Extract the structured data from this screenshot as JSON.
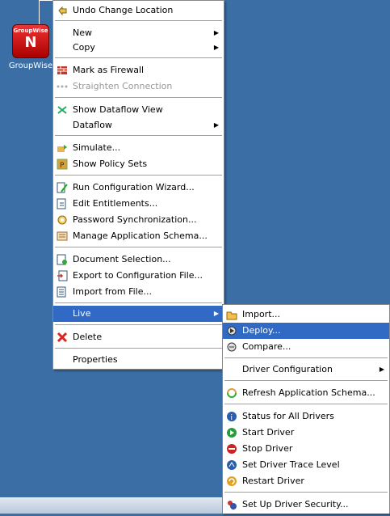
{
  "desktop": {
    "icon_label": "GroupWise",
    "icon_text_top": "GroupWise",
    "icon_text_main": "N"
  },
  "main_menu": {
    "undo": "Undo Change Location",
    "new": "New",
    "copy": "Copy",
    "mark_firewall": "Mark as Firewall",
    "straighten": "Straighten Connection",
    "show_dataflow": "Show Dataflow View",
    "dataflow": "Dataflow",
    "simulate": "Simulate...",
    "show_policy": "Show Policy Sets",
    "run_wizard": "Run Configuration Wizard...",
    "edit_entitlements": "Edit Entitlements...",
    "password_sync": "Password Synchronization...",
    "manage_schema": "Manage Application Schema...",
    "doc_selection": "Document Selection...",
    "export_config": "Export to Configuration File...",
    "import_file": "Import from File...",
    "live": "Live",
    "delete": "Delete",
    "properties": "Properties"
  },
  "live_menu": {
    "import": "Import...",
    "deploy": "Deploy...",
    "compare": "Compare...",
    "driver_config": "Driver Configuration",
    "refresh_schema": "Refresh Application Schema...",
    "status_all": "Status for All Drivers",
    "start": "Start Driver",
    "stop": "Stop Driver",
    "trace_level": "Set Driver Trace Level",
    "restart": "Restart Driver",
    "security": "Set Up Driver Security..."
  },
  "colors": {
    "desktop": "#3a6ea5",
    "highlight": "#316ac5"
  }
}
